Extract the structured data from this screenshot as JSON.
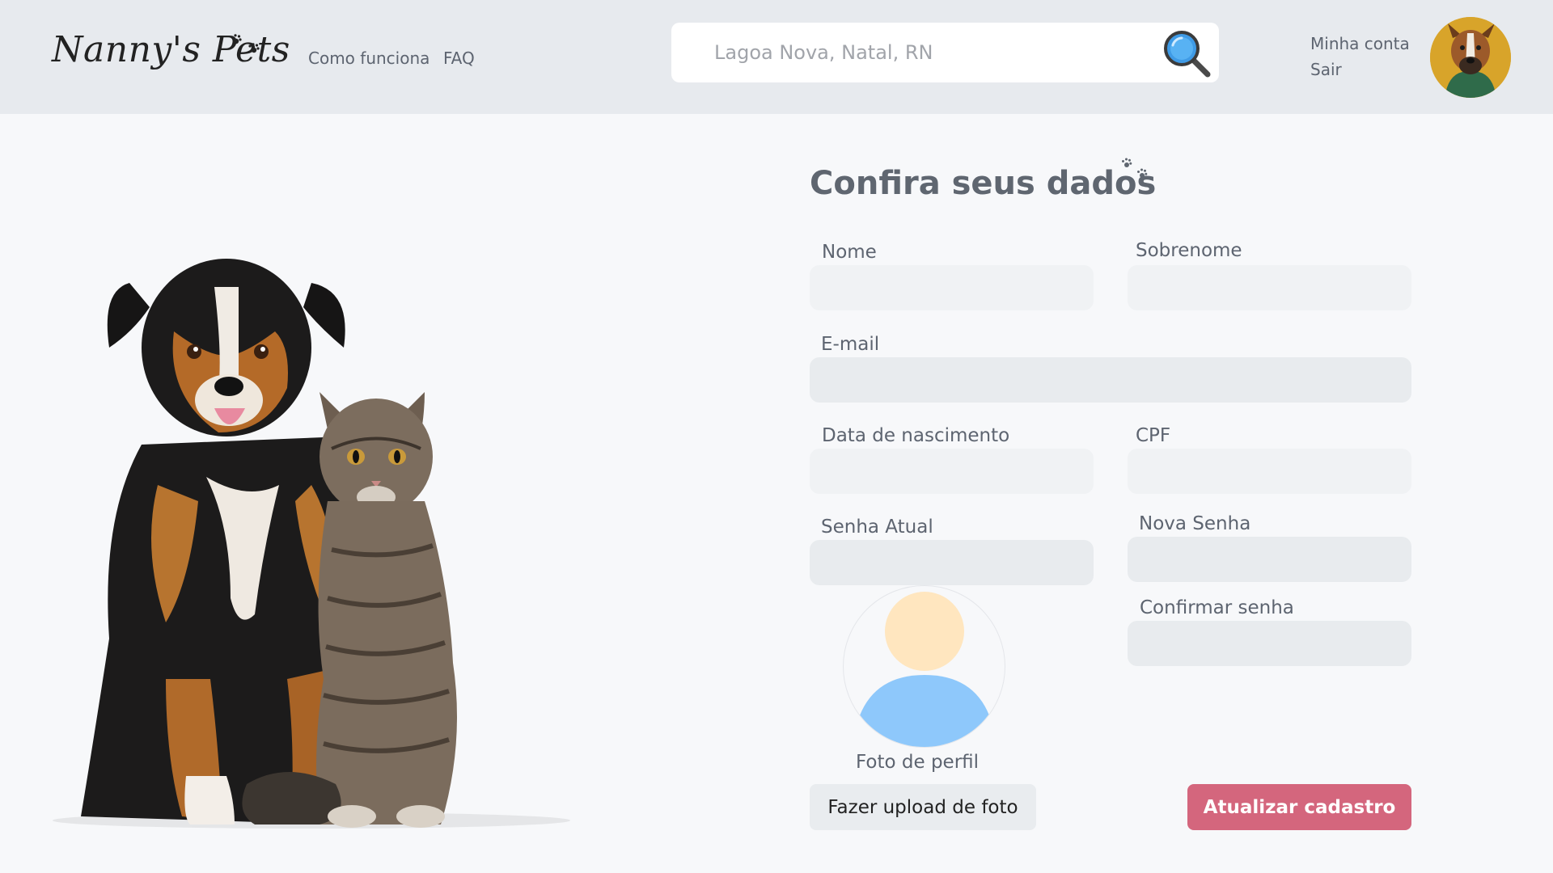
{
  "header": {
    "logo_text": "Nanny's Pets",
    "nav": {
      "how": "Como funciona",
      "faq": "FAQ"
    },
    "search": {
      "placeholder": "Lagoa Nova, Natal, RN",
      "value": ""
    },
    "account": {
      "my_account": "Minha conta",
      "logout": "Sair"
    }
  },
  "form": {
    "title": "Confira seus dados",
    "labels": {
      "first_name": "Nome",
      "last_name": "Sobrenome",
      "email": "E-mail",
      "birth_date": "Data de nascimento",
      "cpf": "CPF",
      "current_password": "Senha Atual",
      "new_password": "Nova Senha",
      "confirm_password": "Confirmar senha"
    },
    "profile_photo_label": "Foto de perfil",
    "upload_button": "Fazer upload de foto",
    "submit_button": "Atualizar cadastro"
  },
  "colors": {
    "header_bg": "#e7eaee",
    "page_bg": "#f7f8fa",
    "input_bg": "#f0f2f4",
    "primary_button": "#d4667d",
    "secondary_button": "#e9ecef",
    "avatar_head": "#ffe6bf",
    "avatar_body": "#8ec8fb"
  },
  "icons": {
    "search": "search-icon",
    "paws": "paw-prints-icon",
    "avatar_placeholder": "user-silhouette-icon"
  }
}
